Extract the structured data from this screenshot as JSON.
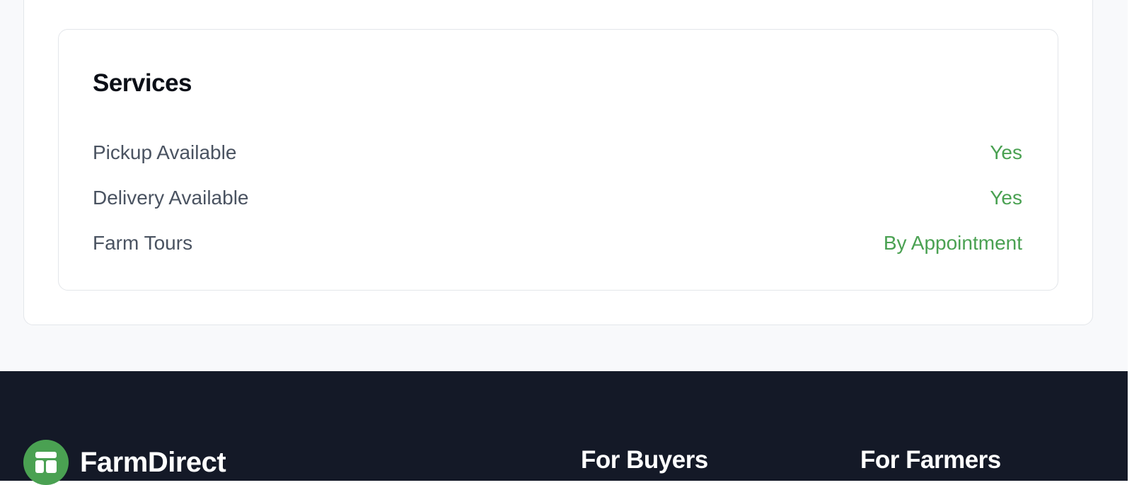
{
  "services": {
    "title": "Services",
    "rows": [
      {
        "label": "Pickup Available",
        "value": "Yes"
      },
      {
        "label": "Delivery Available",
        "value": "Yes"
      },
      {
        "label": "Farm Tours",
        "value": "By Appointment"
      }
    ],
    "value_color": "#4aa152"
  },
  "footer": {
    "brand_name": "FarmDirect",
    "logo_icon": "storefront-icon",
    "brand_color": "#4aa152",
    "background_color": "#141927",
    "headings": [
      "For Buyers",
      "For Farmers"
    ]
  }
}
